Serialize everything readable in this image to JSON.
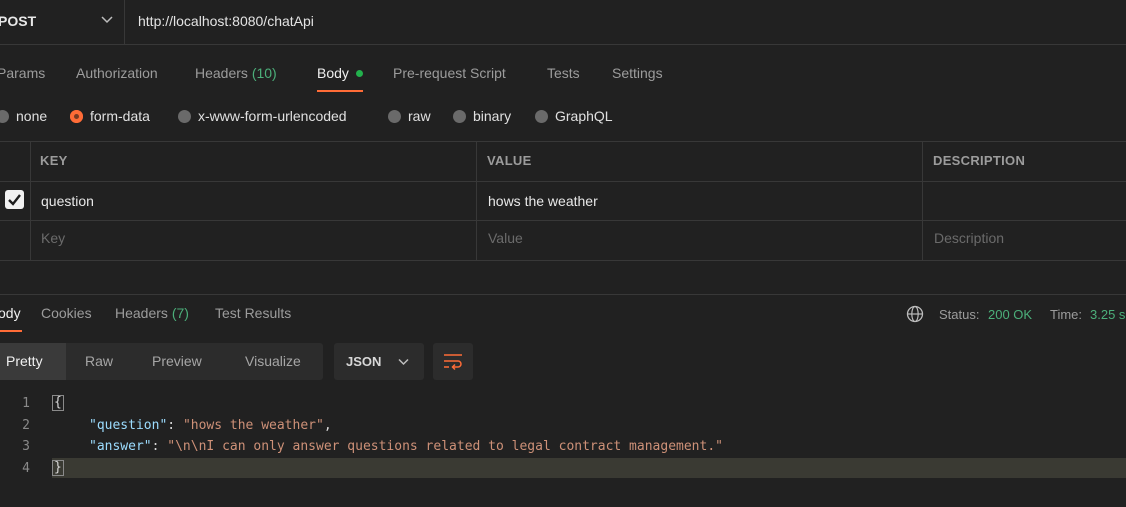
{
  "request": {
    "method": "POST",
    "url": "http://localhost:8080/chatApi",
    "tabs": [
      {
        "label": "Params"
      },
      {
        "label": "Authorization"
      },
      {
        "label": "Headers",
        "count": "(10)"
      },
      {
        "label": "Body"
      },
      {
        "label": "Pre-request Script"
      },
      {
        "label": "Tests"
      },
      {
        "label": "Settings"
      }
    ],
    "body_types": [
      "none",
      "form-data",
      "x-www-form-urlencoded",
      "raw",
      "binary",
      "GraphQL"
    ],
    "selected_body_type": "form-data",
    "table": {
      "headers": [
        "KEY",
        "VALUE",
        "DESCRIPTION"
      ],
      "rows": [
        {
          "checked": true,
          "key": "question",
          "value": "hows the weather",
          "description": ""
        }
      ],
      "placeholders": {
        "key": "Key",
        "value": "Value",
        "description": "Description"
      }
    }
  },
  "response": {
    "tabs": [
      {
        "label": "ody"
      },
      {
        "label": "Cookies"
      },
      {
        "label": "Headers",
        "count": "(7)"
      },
      {
        "label": "Test Results"
      }
    ],
    "status_label": "Status:",
    "status_value": "200 OK",
    "time_label": "Time:",
    "time_value": "3.25 s",
    "views": [
      "Pretty",
      "Raw",
      "Preview",
      "Visualize"
    ],
    "format": "JSON",
    "lines": [
      {
        "num": "1",
        "text": "{"
      },
      {
        "num": "2",
        "key": "\"question\"",
        "value": "\"hows the weather\"",
        "trail": ","
      },
      {
        "num": "3",
        "key": "\"answer\"",
        "value": "\"\\n\\nI can only answer questions related to legal contract management.\"",
        "trail": ""
      },
      {
        "num": "4",
        "text": "}"
      }
    ]
  },
  "colors": {
    "accent": "#ff6c37",
    "success": "#4caf7a",
    "background": "#212121"
  }
}
